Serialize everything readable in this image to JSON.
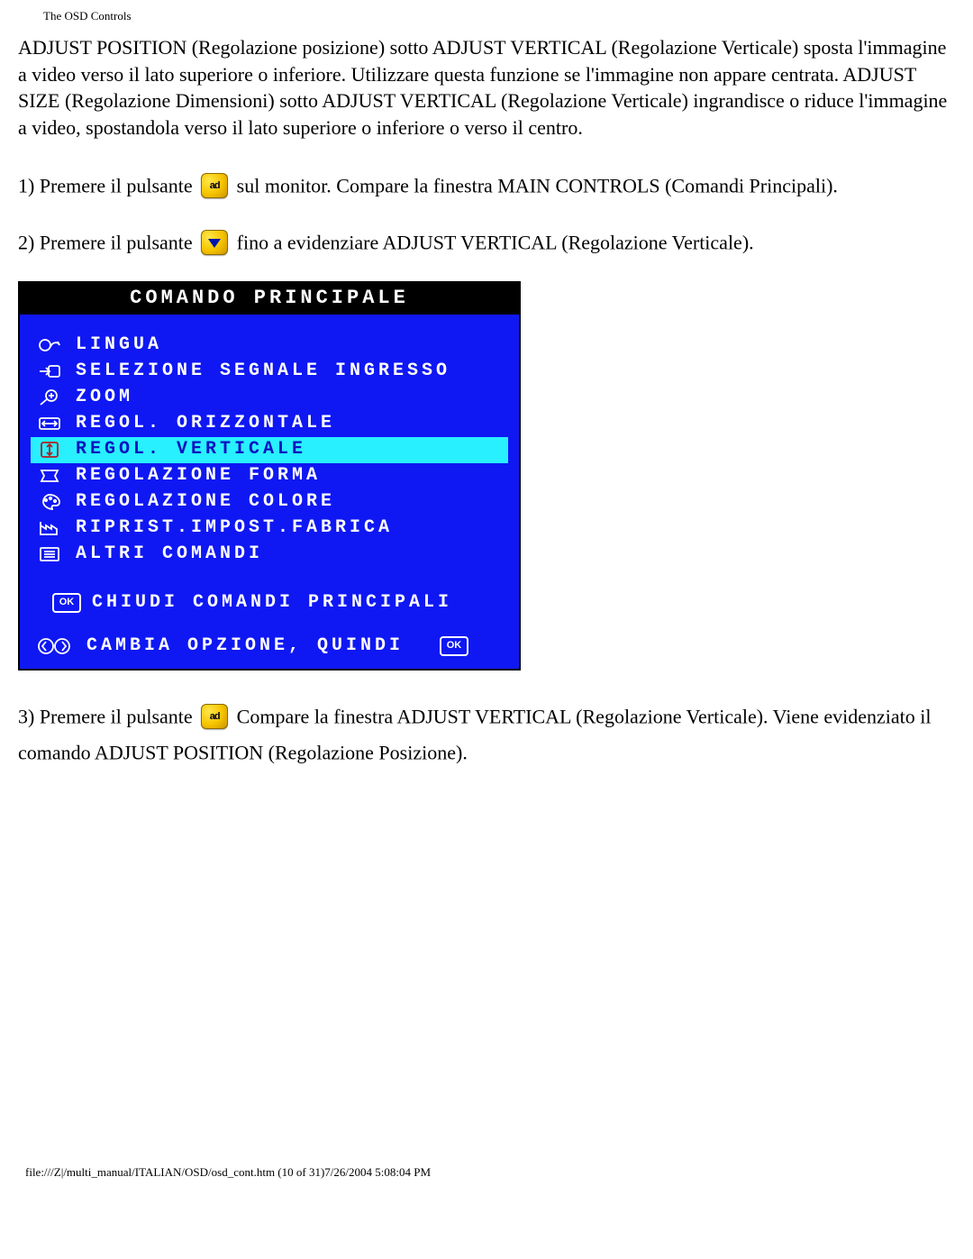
{
  "header": "The OSD Controls",
  "intro": "ADJUST POSITION (Regolazione posizione) sotto ADJUST VERTICAL (Regolazione Verticale) sposta l'immagine a video verso il lato superiore o inferiore. Utilizzare questa funzione se l'immagine non appare centrata. ADJUST SIZE (Regolazione Dimensioni) sotto ADJUST VERTICAL (Regolazione Verticale) ingrandisce o riduce l'immagine a video, spostandola verso il lato superiore o inferiore o verso il centro.",
  "step1a": "1) Premere il pulsante ",
  "step1b": " sul monitor. Compare la finestra MAIN CONTROLS (Comandi Principali).",
  "step2a": "2) Premere il pulsante ",
  "step2b": " fino a evidenziare ADJUST VERTICAL (Regolazione Verticale).",
  "osd": {
    "title": "COMANDO PRINCIPALE",
    "items": [
      {
        "label": "LINGUA"
      },
      {
        "label": "SELEZIONE SEGNALE INGRESSO"
      },
      {
        "label": "ZOOM"
      },
      {
        "label": "REGOL. ORIZZONTALE"
      },
      {
        "label": "REGOL. VERTICALE"
      },
      {
        "label": "REGOLAZIONE FORMA"
      },
      {
        "label": "REGOLAZIONE COLORE"
      },
      {
        "label": "RIPRIST.IMPOST.FABRICA"
      },
      {
        "label": "ALTRI COMANDI"
      }
    ],
    "close": "CHIUDI COMANDI PRINCIPALI",
    "hint": "CAMBIA OPZIONE, QUINDI",
    "ok": "OK"
  },
  "step3a": "3) Premere il pulsante ",
  "step3b": " Compare la finestra ADJUST VERTICAL (Regolazione Verticale). Viene evidenziato il comando ADJUST POSITION (Regolazione Posizione).",
  "footer": "file:///Z|/multi_manual/ITALIAN/OSD/osd_cont.htm (10 of 31)7/26/2004 5:08:04 PM"
}
